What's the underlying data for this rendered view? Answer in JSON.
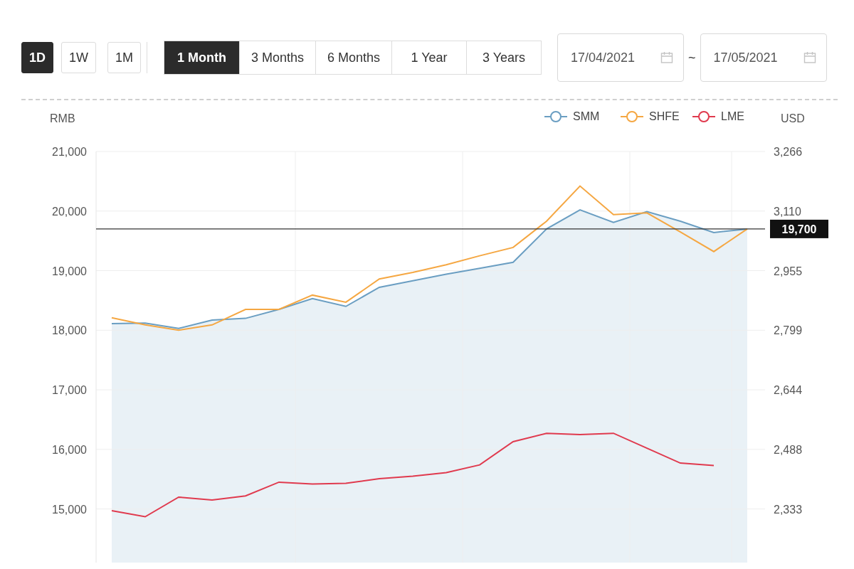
{
  "intervals": [
    {
      "label": "1D",
      "selected": true
    },
    {
      "label": "1W",
      "selected": false
    },
    {
      "label": "1M",
      "selected": false
    }
  ],
  "ranges": [
    {
      "label": "1 Month",
      "selected": true
    },
    {
      "label": "3 Months",
      "selected": false
    },
    {
      "label": "6 Months",
      "selected": false
    },
    {
      "label": "1 Year",
      "selected": false
    },
    {
      "label": "3 Years",
      "selected": false
    }
  ],
  "date_range": {
    "start": "17/04/2021",
    "separator": "~",
    "end": "17/05/2021"
  },
  "chart": {
    "chart_data": {
      "type": "line",
      "ylabel": "RMB",
      "ylim": [
        14100,
        21000
      ],
      "yticks": [
        {
          "value": 15000,
          "label": "15,000"
        },
        {
          "value": 16000,
          "label": "16,000"
        },
        {
          "value": 17000,
          "label": "17,000"
        },
        {
          "value": 18000,
          "label": "18,000"
        },
        {
          "value": 19000,
          "label": "19,000"
        },
        {
          "value": 20000,
          "label": "20,000"
        },
        {
          "value": 21000,
          "label": "21,000"
        }
      ],
      "series": [
        {
          "name": "SMM",
          "type": "area",
          "color": "#6a9ec2",
          "values": [
            18110,
            18120,
            18030,
            18170,
            18200,
            18350,
            18530,
            18400,
            18720,
            18830,
            18940,
            19040,
            19140,
            19700,
            20020,
            19810,
            19990,
            19830,
            19640,
            19700
          ]
        },
        {
          "name": "SHFE",
          "type": "line",
          "color": "#f5a742",
          "values": [
            18210,
            18090,
            18000,
            18090,
            18350,
            18350,
            18590,
            18470,
            18860,
            18970,
            19100,
            19250,
            19390,
            19830,
            20420,
            19940,
            19970,
            19650,
            19320,
            19700
          ]
        },
        {
          "name": "LME",
          "type": "line",
          "color": "#e03a4e",
          "values": [
            14970,
            14870,
            15200,
            15150,
            15220,
            15450,
            15420,
            15430,
            15510,
            15550,
            15610,
            15740,
            16130,
            16270,
            16250,
            16270,
            16020,
            15770,
            15730,
            null
          ]
        }
      ],
      "ref_lines": [
        {
          "axis": "y",
          "value": 19700,
          "label": "19,700"
        }
      ],
      "grid": true,
      "legend": true
    },
    "right_axis": {
      "title": "USD",
      "ticks": [
        "3,266",
        "3,110",
        "2,955",
        "2,799",
        "2,644",
        "2,488",
        "2,333"
      ]
    }
  }
}
